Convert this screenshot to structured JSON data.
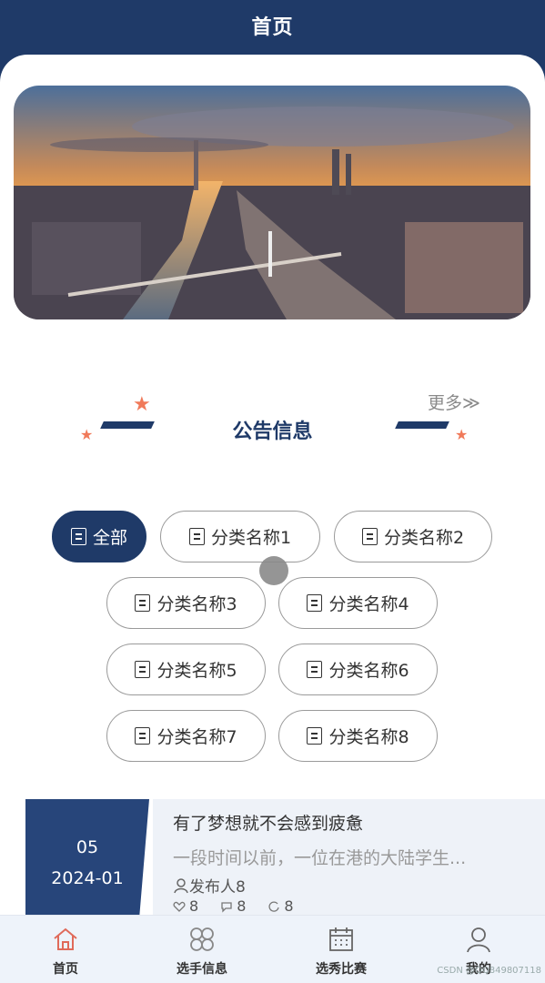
{
  "header": {
    "title": "首页"
  },
  "section": {
    "title": "公告信息",
    "more": "更多≫"
  },
  "categories": [
    "全部",
    "分类名称1",
    "分类名称2",
    "分类名称3",
    "分类名称4",
    "分类名称5",
    "分类名称6",
    "分类名称7",
    "分类名称8"
  ],
  "news": [
    {
      "day": "05",
      "year_month": "2024-01",
      "title": "有了梦想就不会感到疲惫",
      "summary": "一段时间以前，一位在港的大陆学生...",
      "publisher": "发布人8",
      "likes": "8",
      "comments": "8",
      "views": "8"
    }
  ],
  "tabbar": {
    "items": [
      "首页",
      "选手信息",
      "选秀比赛",
      "我的"
    ]
  },
  "watermark": "CSDN @QQ849807118",
  "colors": {
    "primary": "#1f3a68",
    "accent_star": "#f07a5a",
    "tab_active_icon": "#e06a5a"
  }
}
